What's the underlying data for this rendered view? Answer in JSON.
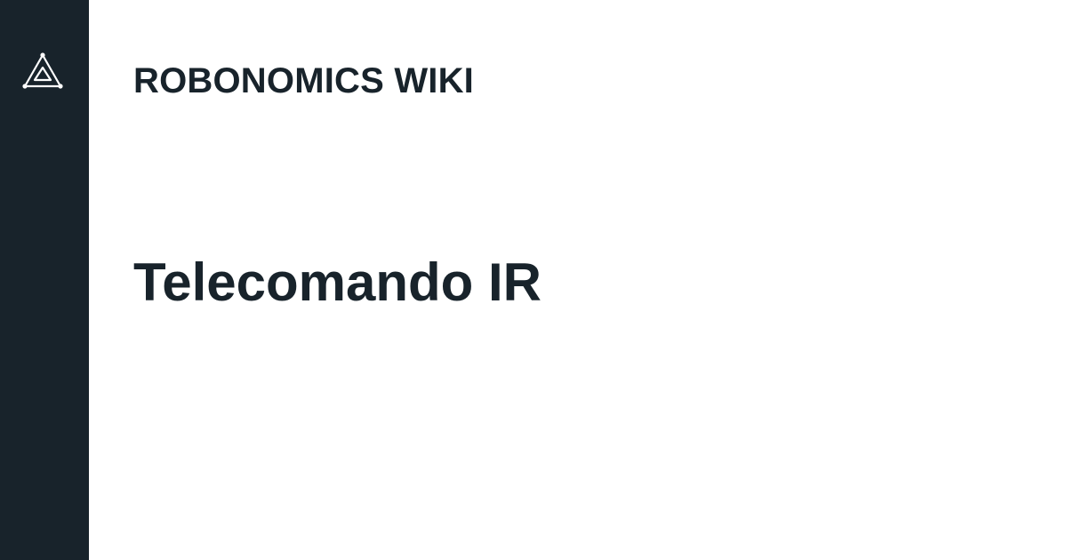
{
  "brand": {
    "logo_icon": "robonomics-triangle-logo-icon",
    "site_title": "ROBONOMICS WIKI"
  },
  "page": {
    "title": "Telecomando IR"
  },
  "colors": {
    "sidebar_bg": "#18232b",
    "text": "#18232b",
    "background": "#ffffff",
    "logo_stroke": "#ffffff"
  }
}
